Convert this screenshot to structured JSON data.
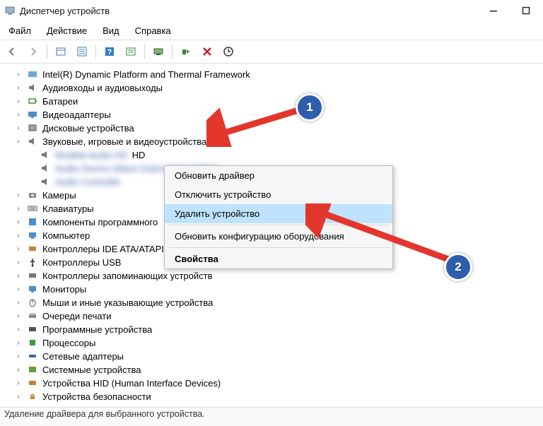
{
  "window": {
    "title": "Диспетчер устройств"
  },
  "menu": {
    "file": "Файл",
    "action": "Действие",
    "view": "Вид",
    "help": "Справка"
  },
  "tree": {
    "items": [
      "Intel(R) Dynamic Platform and Thermal Framework",
      "Аудиовходы и аудиовыходы",
      "Батареи",
      "Видеоадаптеры",
      "Дисковые устройства",
      "Звуковые, игровые и видеоустройства"
    ],
    "sound_children": [
      "Realtek Audio HD",
      "Audio Device (Wave Extensible) (WDM)",
      "Audio Controller"
    ],
    "items_after": [
      "Камеры",
      "Клавиатуры",
      "Компоненты программного",
      "Компьютер",
      "Контроллеры IDE ATA/ATAPI",
      "Контроллеры USB",
      "Контроллеры запоминающих устройств",
      "Мониторы",
      "Мыши и иные указывающие устройства",
      "Очереди печати",
      "Программные устройства",
      "Процессоры",
      "Сетевые адаптеры",
      "Системные устройства",
      "Устройства HID (Human Interface Devices)",
      "Устройства безопасности"
    ]
  },
  "context_menu": {
    "update_driver": "Обновить драйвер",
    "disable_device": "Отключить устройство",
    "uninstall_device": "Удалить устройство",
    "scan_hardware": "Обновить конфигурацию оборудования",
    "properties": "Свойства"
  },
  "status": {
    "text": "Удаление драйвера для выбранного устройства."
  },
  "annotations": {
    "badge1": "1",
    "badge2": "2"
  }
}
